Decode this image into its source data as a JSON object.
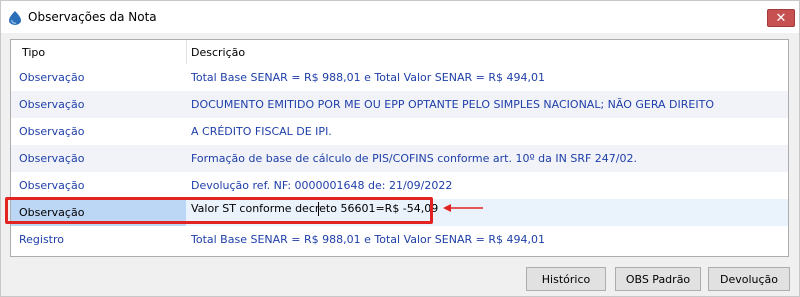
{
  "window": {
    "title": "Observações da Nota",
    "close_label": "✕"
  },
  "grid": {
    "columns": [
      "Tipo",
      "Descrição"
    ],
    "rows": [
      {
        "tipo": "Observação",
        "descricao": "Total Base SENAR = R$ 988,01 e Total Valor SENAR = R$ 494,01"
      },
      {
        "tipo": "Observação",
        "descricao": "DOCUMENTO EMITIDO POR ME OU EPP OPTANTE PELO SIMPLES NACIONAL; NÃO GERA DIREITO"
      },
      {
        "tipo": "Observação",
        "descricao": "A CRÉDITO FISCAL DE IPI."
      },
      {
        "tipo": "Observação",
        "descricao": "Formação de base de cálculo de PIS/COFINS conforme art. 10º da IN SRF 247/02."
      },
      {
        "tipo": "Observação",
        "descricao": "Devolução ref. NF: 0000001648 de: 21/09/2022"
      },
      {
        "tipo": "Observação",
        "descricao": "Valor ST conforme decreto 56601=R$ -54,09"
      },
      {
        "tipo": "Registro",
        "descricao": "Total Base SENAR = R$ 988,01 e Total Valor SENAR = R$ 494,01"
      }
    ],
    "selected_row": 5
  },
  "buttons": {
    "historico": "Histórico",
    "obs_padrao": "OBS Padrão",
    "devolucao": "Devolução"
  },
  "colors": {
    "accent": "#1e3fa8",
    "annotation": "#e32222",
    "selection": "#bcd6f5"
  }
}
